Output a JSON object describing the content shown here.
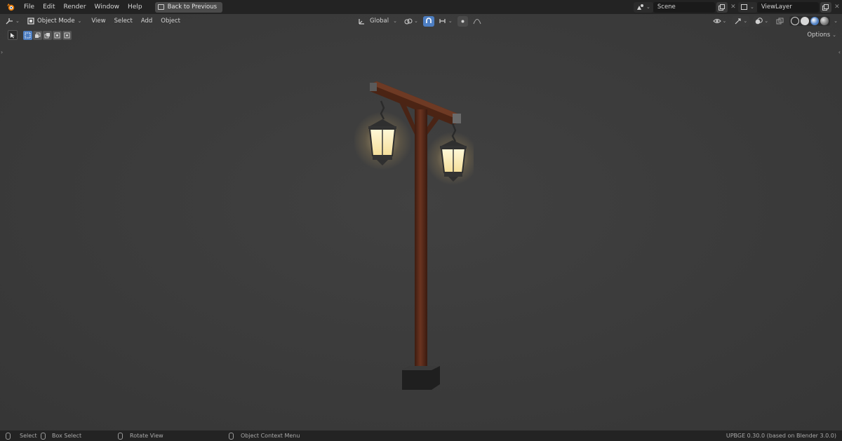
{
  "menu": {
    "items": [
      "File",
      "Edit",
      "Render",
      "Window",
      "Help"
    ],
    "back_button": "Back to Previous"
  },
  "scene": {
    "name": "Scene"
  },
  "view_layer": {
    "name": "ViewLayer"
  },
  "viewport_header": {
    "mode": "Object Mode",
    "menus": [
      "View",
      "Select",
      "Add",
      "Object"
    ],
    "orientation": "Global"
  },
  "tool_header": {
    "options_label": "Options"
  },
  "statusbar": {
    "hints": [
      "Select",
      "Box Select",
      "Rotate View",
      "Object Context Menu"
    ],
    "version": "UPBGE 0.30.0 (based on Blender 3.0.0)"
  },
  "colors": {
    "accent": "#4d7ec2",
    "logo": "#e87d0d",
    "viewport_bg": "#3d3d3d",
    "lamp_glow": "#fff2c4",
    "wood": "#5b2c1a"
  },
  "icons": [
    "blender-logo-icon",
    "back-icon",
    "scene-icon",
    "view-layer-icon",
    "editor-type-icon",
    "object-mode-icon",
    "transform-orientation-icon",
    "pivot-icon",
    "snap-icon",
    "proportional-edit-icon",
    "visibility-icon",
    "gizmo-icon",
    "overlay-icon",
    "xray-icon",
    "wireframe-shading-icon",
    "solid-shading-icon",
    "material-shading-icon",
    "rendered-shading-icon",
    "select-tool-icon",
    "mouse-icon"
  ]
}
